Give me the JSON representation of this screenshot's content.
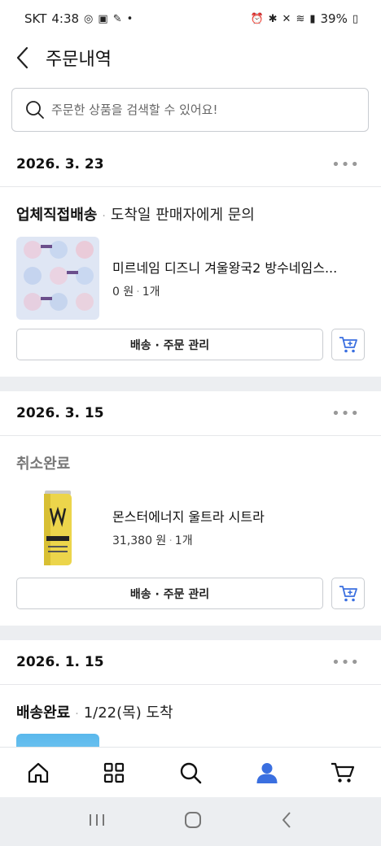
{
  "status_bar": {
    "carrier": "SKT",
    "time": "4:38",
    "battery": "39%"
  },
  "header": {
    "title": "주문내역"
  },
  "search": {
    "placeholder": "주문한 상품을 검색할 수 있어요!"
  },
  "orders": [
    {
      "date": "2026. 3. 23",
      "status": "업체직접배송",
      "status_sub": "도착일 판매자에게 문의",
      "product_name": "미르네임 디즈니 겨울왕국2 방수네임스...",
      "price": "0 원",
      "qty": "1개",
      "manage_label": "배송 · 주문 관리"
    },
    {
      "date": "2026. 3. 15",
      "status": "취소완료",
      "status_sub": "",
      "product_name": "몬스터에너지 울트라 시트라",
      "price": "31,380 원",
      "qty": "1개",
      "manage_label": "배송 · 주문 관리"
    },
    {
      "date": "2026. 1. 15",
      "status": "배송완료",
      "status_sub": "1/22(목) 도착"
    }
  ],
  "icons": {
    "back": "chevron-left-icon",
    "search": "search-icon",
    "more": "more-horizontal-icon",
    "cart_add": "cart-plus-icon",
    "nav": [
      "home-icon",
      "grid-icon",
      "search-icon",
      "person-icon",
      "cart-icon"
    ]
  },
  "colors": {
    "accent": "#3a6fe0",
    "cancel_status": "#777777"
  }
}
